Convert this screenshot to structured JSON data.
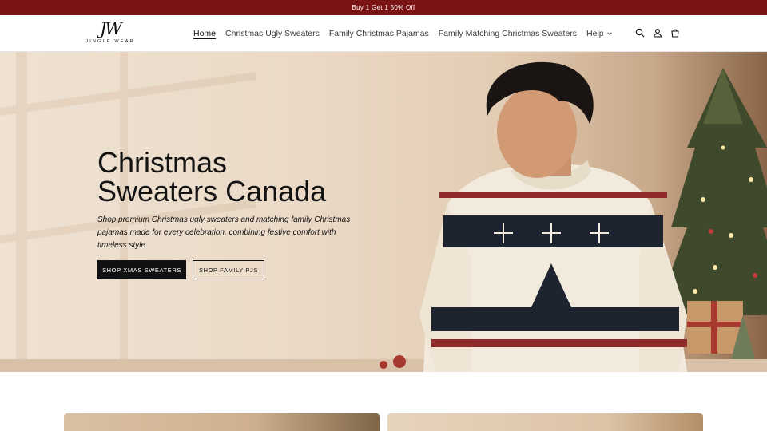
{
  "announcement": {
    "text": "Buy 1 Get 1 50% Off"
  },
  "brand": {
    "mark": "JW",
    "name": "JINGLE WEAR"
  },
  "nav": {
    "items": [
      {
        "label": "Home",
        "active": true
      },
      {
        "label": "Christmas Ugly Sweaters",
        "active": false
      },
      {
        "label": "Family Christmas Pajamas",
        "active": false
      },
      {
        "label": "Family Matching Christmas Sweaters",
        "active": false
      },
      {
        "label": "Help",
        "active": false,
        "has_dropdown": true
      }
    ]
  },
  "header_icons": [
    "search-icon",
    "account-icon",
    "cart-icon"
  ],
  "hero": {
    "title_line1": "Christmas",
    "title_line2": "Sweaters Canada",
    "subtitle": "Shop premium Christmas ugly sweaters and matching family Christmas pajamas made for every celebration, combining festive comfort with timeless style.",
    "primary_button": "SHOP XMAS SWEATERS",
    "secondary_button": "SHOP FAMILY PJS"
  },
  "colors": {
    "announcement_bg": "#7a1414",
    "button_primary_bg": "#111111",
    "text": "#121212"
  }
}
